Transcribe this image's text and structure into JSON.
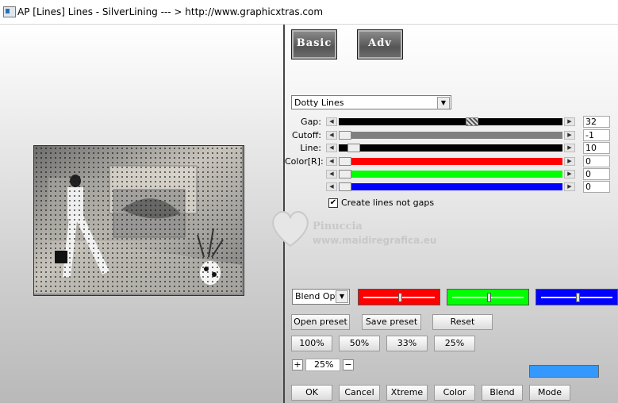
{
  "titlebar": {
    "title": "AP [Lines]  Lines - SilverLining     --- > http://www.graphicxtras.com"
  },
  "modes": {
    "basic": "Basic",
    "adv": "Adv"
  },
  "effect": {
    "selected": "Dotty Lines"
  },
  "sliders": [
    {
      "label": "Gap:",
      "value": "32",
      "fill": "#000000",
      "level": 0.6
    },
    {
      "label": "Cutoff:",
      "value": "-1",
      "fill": "#808080",
      "level": 0.0
    },
    {
      "label": "Line:",
      "value": "10",
      "fill": "#000000",
      "level": 0.04
    },
    {
      "label": "Color[R]:",
      "value": "0",
      "fill": "#ff0000",
      "level": 0.0
    },
    {
      "label": "",
      "value": "0",
      "fill": "#00ff00",
      "level": 0.0
    },
    {
      "label": "",
      "value": "0",
      "fill": "#0000ff",
      "level": 0.0
    }
  ],
  "options": {
    "create_lines_label": "Create lines not gaps",
    "create_lines_checked": true
  },
  "blend": {
    "selected": "Blend Optio",
    "channels": [
      {
        "color": "#ff0000",
        "level": 0.5
      },
      {
        "color": "#00ff00",
        "level": 0.5
      },
      {
        "color": "#0000ff",
        "level": 0.5
      }
    ]
  },
  "presets": {
    "open": "Open preset",
    "save": "Save preset",
    "reset": "Reset"
  },
  "zoom_buttons": [
    "100%",
    "50%",
    "33%",
    "25%"
  ],
  "zoom": {
    "plus": "+",
    "value": "25%",
    "minus": "−"
  },
  "swatch_color": "#3399ff",
  "actions": [
    "OK",
    "Cancel",
    "Xtreme",
    "Color",
    "Blend",
    "Mode"
  ],
  "watermark": {
    "line1": "Pinuccia",
    "line2": "www.maidiregrafica.eu"
  }
}
